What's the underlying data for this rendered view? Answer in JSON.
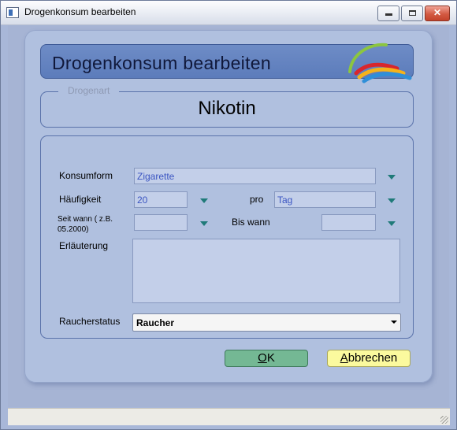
{
  "window": {
    "title": "Drogenkonsum bearbeiten",
    "buttons": {
      "minimize": "minimize",
      "maximize": "maximize",
      "close": "✕"
    }
  },
  "header": {
    "title": "Drogenkonsum bearbeiten",
    "logo": "rainbow-swoosh-logo"
  },
  "drogenart": {
    "legend": "Drogenart",
    "value": "Nikotin"
  },
  "form": {
    "konsumform": {
      "label": "Konsumform",
      "value": "Zigarette"
    },
    "haeufigkeit": {
      "label": "Häufigkeit",
      "value": "20"
    },
    "pro": {
      "label": "pro",
      "value": "Tag"
    },
    "seit_wann": {
      "label_line1": "Seit wann ( z.B.",
      "label_line2": "05.2000)",
      "value": ""
    },
    "bis_wann": {
      "label": "Bis wann",
      "value": ""
    },
    "erlaeuterung": {
      "label": "Erläuterung",
      "value": ""
    },
    "raucherstatus": {
      "label": "Raucherstatus",
      "value": "Raucher"
    }
  },
  "actions": {
    "ok": {
      "mnemonic": "O",
      "rest": "K"
    },
    "cancel": {
      "mnemonic": "A",
      "rest": "bbrechen"
    }
  },
  "colors": {
    "panel": "#b0c0df",
    "header": "#5c7cbb",
    "input": "#c3cfe9",
    "dropdown_arrow": "#1f7a79",
    "ok_button": "#74b894",
    "cancel_button": "#fbfa9e"
  }
}
